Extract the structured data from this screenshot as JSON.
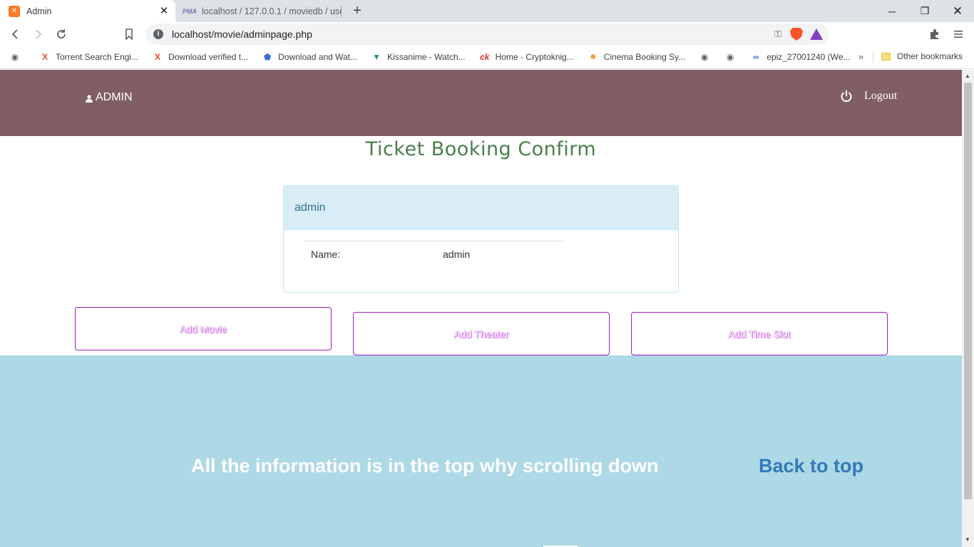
{
  "browser": {
    "tabs": [
      {
        "title": "Admin",
        "active": true,
        "icon": "xampp-icon"
      },
      {
        "title": "localhost / 127.0.0.1 / moviedb / user",
        "active": false,
        "icon": "phpmyadmin-icon"
      }
    ],
    "url": "localhost/movie/adminpage.php",
    "bookmarks": [
      {
        "label": "Torrent Search Engi...",
        "icon": "x-icon"
      },
      {
        "label": "Download verified t...",
        "icon": "x-icon"
      },
      {
        "label": "Download and Wat...",
        "icon": "shield-icon"
      },
      {
        "label": "Kissanime - Watch...",
        "icon": "kissanime-icon"
      },
      {
        "label": "Home - Cryptoknig...",
        "icon": "cryptoknight-icon"
      },
      {
        "label": "Cinema Booking Sy...",
        "icon": "cinema-icon"
      },
      {
        "label": "",
        "icon": "globe-icon"
      },
      {
        "label": "",
        "icon": "globe-icon"
      },
      {
        "label": "epiz_27001240 (We...",
        "icon": "infinity-icon"
      }
    ],
    "other_bookmarks": "Other bookmarks",
    "more_bookmarks": "»"
  },
  "header": {
    "brand": "ADMIN",
    "logout": "Logout"
  },
  "page": {
    "title": "Ticket Booking Confirm",
    "panel": {
      "heading": "admin",
      "name_label": "Name:",
      "name_value": "admin"
    },
    "actions": {
      "add_movie": "Add Movie",
      "add_theater": "Add Theater",
      "add_time_slot": "Add Time Slot"
    }
  },
  "footer": {
    "message": "All the information is in the top why scrolling down",
    "back_to_top": "Back to top"
  },
  "colors": {
    "header_bg": "#805e63",
    "title": "#4a7f4a",
    "panel_heading_bg": "#d9edf7",
    "button_border": "#9b1dbf",
    "footer_bg": "#add8e6",
    "link": "#337ab7"
  }
}
